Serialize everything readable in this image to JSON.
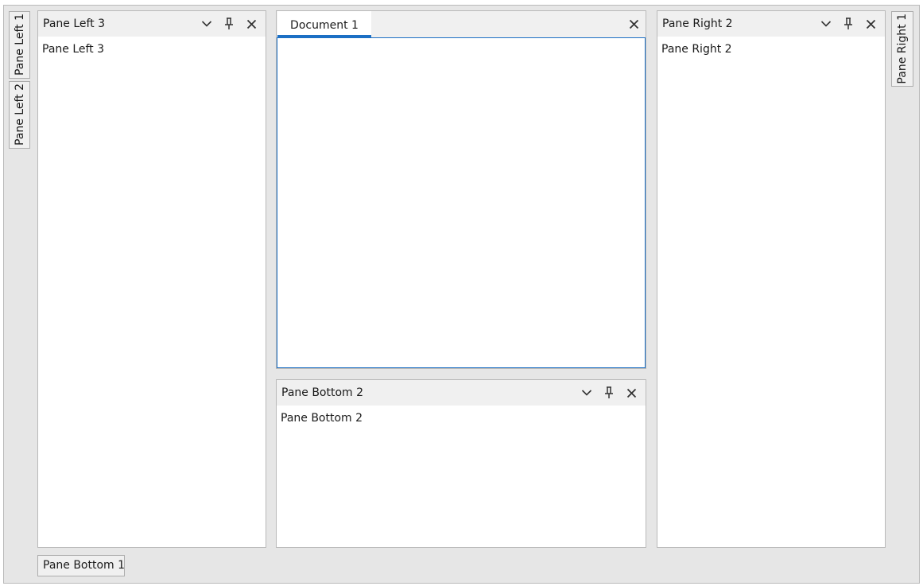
{
  "left_autohide_tabs": [
    {
      "label": "Pane Left 1"
    },
    {
      "label": "Pane Left 2"
    }
  ],
  "right_autohide_tabs": [
    {
      "label": "Pane Right 1"
    }
  ],
  "bottom_autohide_tabs": [
    {
      "label": "Pane Bottom 1"
    }
  ],
  "pane_left_3": {
    "title": "Pane Left 3",
    "content": "Pane Left 3"
  },
  "document": {
    "tab_label": "Document 1",
    "accent": "#1c6fc4"
  },
  "pane_bottom_2": {
    "title": "Pane Bottom 2",
    "content": "Pane Bottom 2"
  },
  "pane_right_2": {
    "title": "Pane Right 2",
    "content": "Pane Right 2"
  },
  "icons": {
    "options": "chevron-down-icon",
    "pin": "pin-icon",
    "close": "close-icon"
  }
}
